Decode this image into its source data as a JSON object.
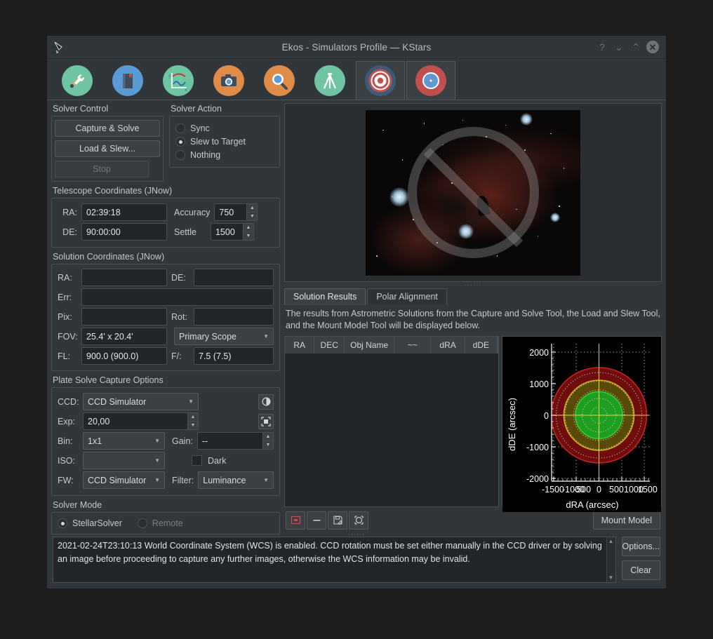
{
  "window": {
    "title": "Ekos - Simulators Profile — KStars",
    "titlebar_buttons": [
      "?",
      "⌄",
      "⌃",
      "✕"
    ]
  },
  "module_tabs": [
    {
      "name": "setup",
      "icon": "tools-icon",
      "selected": false
    },
    {
      "name": "scheduler",
      "icon": "notebook-icon",
      "selected": false
    },
    {
      "name": "analyze",
      "icon": "graph-icon",
      "selected": false
    },
    {
      "name": "capture",
      "icon": "camera-icon",
      "selected": false
    },
    {
      "name": "focus",
      "icon": "magnifier-icon",
      "selected": false
    },
    {
      "name": "mount",
      "icon": "tripod-icon",
      "selected": false
    },
    {
      "name": "align",
      "icon": "bullseye-icon",
      "selected": true
    },
    {
      "name": "guide",
      "icon": "compass-icon",
      "selected": false
    }
  ],
  "solver_control": {
    "title": "Solver Control",
    "capture_solve": "Capture & Solve",
    "load_slew": "Load & Slew...",
    "stop": "Stop"
  },
  "solver_action": {
    "title": "Solver Action",
    "options": [
      {
        "label": "Sync",
        "selected": false
      },
      {
        "label": "Slew to Target",
        "selected": true
      },
      {
        "label": "Nothing",
        "selected": false
      }
    ]
  },
  "telescope_coordinates": {
    "title": "Telescope Coordinates (JNow)",
    "ra_label": "RA:",
    "ra_value": "02:39:18",
    "de_label": "DE:",
    "de_value": "90:00:00",
    "accuracy_label": "Accuracy",
    "accuracy_value": "750",
    "settle_label": "Settle",
    "settle_value": "1500"
  },
  "solution_coordinates": {
    "title": "Solution Coordinates (JNow)",
    "ra_label": "RA:",
    "ra_value": "",
    "de_label": "DE:",
    "de_value": "",
    "err_label": "Err:",
    "err_value": "",
    "pix_label": "Pix:",
    "pix_value": "",
    "rot_label": "Rot:",
    "rot_value": "",
    "fov_label": "FOV:",
    "fov_value": "25.4' x 20.4'",
    "scope_value": "Primary Scope",
    "fl_label": "FL:",
    "fl_value": "900.0 (900.0)",
    "fr_label": "F/:",
    "fr_value": "7.5 (7.5)"
  },
  "capture_options": {
    "title": "Plate Solve Capture Options",
    "ccd_label": "CCD:",
    "ccd_value": "CCD Simulator",
    "exp_label": "Exp:",
    "exp_value": "20,00",
    "bin_label": "Bin:",
    "bin_value": "1x1",
    "gain_label": "Gain:",
    "gain_value": "--",
    "iso_label": "ISO:",
    "iso_value": "",
    "dark_label": "Dark",
    "fw_label": "FW:",
    "fw_value": "CCD Simulator",
    "filter_label": "Filter:",
    "filter_value": "Luminance",
    "eye_icon": "eye-preview-icon",
    "frame_icon": "fit-frame-icon"
  },
  "solver_mode": {
    "title": "Solver Mode",
    "options": [
      {
        "label": "StellarSolver",
        "selected": true,
        "disabled": false
      },
      {
        "label": "Remote",
        "selected": false,
        "disabled": true
      }
    ]
  },
  "preview": {
    "overlay_icon": "no-image-prohibition-icon"
  },
  "result_tabs": [
    {
      "label": "Solution Results",
      "selected": true
    },
    {
      "label": "Polar Alignment",
      "selected": false
    }
  ],
  "results": {
    "description": "The results from Astrometric Solutions from the Capture and Solve Tool, the Load and Slew Tool, and the Mount Model Tool will be displayed below.",
    "columns": [
      "RA",
      "DEC",
      "Obj Name",
      "~~",
      "dRA",
      "dDE"
    ],
    "rows": []
  },
  "bottom_toolbar": {
    "buttons": [
      {
        "name": "stop-record-icon",
        "label": ""
      },
      {
        "name": "minus-icon",
        "label": ""
      },
      {
        "name": "save-disk-icon",
        "label": ""
      },
      {
        "name": "target-crosshair-icon",
        "label": ""
      }
    ],
    "mount_model": "Mount Model"
  },
  "log": {
    "text": "2021-02-24T23:10:13 World Coordinate System (WCS) is enabled. CCD rotation must be set either manually in the CCD driver or by solving an image before proceeding to capture any further images, otherwise the WCS information may be invalid.",
    "options_button": "Options...",
    "clear_button": "Clear"
  },
  "chart_data": {
    "type": "scatter",
    "title": "",
    "xlabel": "dRA (arcsec)",
    "ylabel": "dDE (arcsec)",
    "xlim": [
      -1700,
      1700
    ],
    "ylim": [
      -2300,
      2300
    ],
    "xticks": [
      -1500,
      -1000,
      -500,
      0,
      500,
      1000,
      1500
    ],
    "yticks": [
      2000,
      1000,
      0,
      -1000,
      -2000
    ],
    "grid": true,
    "legend": "none",
    "series": [
      {
        "name": "outer tolerance ring",
        "type": "disk",
        "center": [
          0,
          0
        ],
        "radius": 1500,
        "color": "#8b0f0f"
      },
      {
        "name": "mid tolerance ring",
        "type": "circle",
        "center": [
          0,
          0
        ],
        "radius": 1100,
        "color": "#c8a21c"
      },
      {
        "name": "inner tolerance ring",
        "type": "disk",
        "center": [
          0,
          0
        ],
        "radius": 740,
        "color": "#1faa1f"
      },
      {
        "name": "polar grid",
        "type": "polar-grid",
        "color": "#e6e6e6"
      }
    ],
    "colors": {
      "background": "#000000",
      "axis": "#ffffff",
      "crosshair": "#e8d44a",
      "grid": "#ffffff"
    }
  },
  "colors": {
    "window_bg": "#31363b",
    "panel_bg": "#2b2e31",
    "field_bg": "#232629",
    "text": "#c6cace",
    "border": "#4a4f54",
    "accent_green": "#6fc5a3",
    "accent_orange": "#e08b48",
    "accent_blue": "#5b9bd5",
    "accent_red": "#c0504d"
  }
}
